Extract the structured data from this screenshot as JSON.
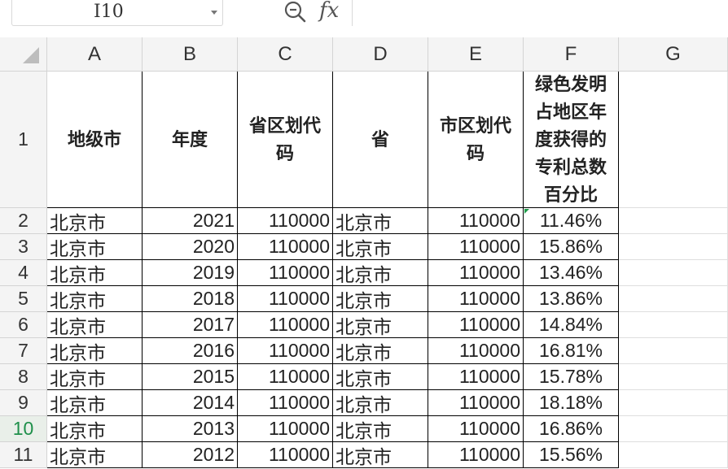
{
  "formula_bar": {
    "cell_ref": "I10",
    "fx_label": "fx",
    "formula_value": ""
  },
  "columns": [
    "A",
    "B",
    "C",
    "D",
    "E",
    "F",
    "G"
  ],
  "header_row": {
    "row_number": "1",
    "A": "地级市",
    "B": "年度",
    "C": "省区划代码",
    "D": "省",
    "E": "市区划代码",
    "F": "绿色发明占地区年度获得的专利总数百分比"
  },
  "rows": [
    {
      "n": "2",
      "A": "北京市",
      "B": "2021",
      "C": "110000",
      "D": "北京市",
      "E": "110000",
      "F": "11.46%"
    },
    {
      "n": "3",
      "A": "北京市",
      "B": "2020",
      "C": "110000",
      "D": "北京市",
      "E": "110000",
      "F": "15.86%"
    },
    {
      "n": "4",
      "A": "北京市",
      "B": "2019",
      "C": "110000",
      "D": "北京市",
      "E": "110000",
      "F": "13.46%"
    },
    {
      "n": "5",
      "A": "北京市",
      "B": "2018",
      "C": "110000",
      "D": "北京市",
      "E": "110000",
      "F": "13.86%"
    },
    {
      "n": "6",
      "A": "北京市",
      "B": "2017",
      "C": "110000",
      "D": "北京市",
      "E": "110000",
      "F": "14.84%"
    },
    {
      "n": "7",
      "A": "北京市",
      "B": "2016",
      "C": "110000",
      "D": "北京市",
      "E": "110000",
      "F": "16.81%"
    },
    {
      "n": "8",
      "A": "北京市",
      "B": "2015",
      "C": "110000",
      "D": "北京市",
      "E": "110000",
      "F": "15.78%"
    },
    {
      "n": "9",
      "A": "北京市",
      "B": "2014",
      "C": "110000",
      "D": "北京市",
      "E": "110000",
      "F": "18.18%"
    },
    {
      "n": "10",
      "A": "北京市",
      "B": "2013",
      "C": "110000",
      "D": "北京市",
      "E": "110000",
      "F": "16.86%"
    },
    {
      "n": "11",
      "A": "北京市",
      "B": "2012",
      "C": "110000",
      "D": "北京市",
      "E": "110000",
      "F": "15.56%"
    }
  ],
  "active_row": "10",
  "colors": {
    "active_row_header": "#1e8f4a",
    "header_bg": "#f4f4f4",
    "gridline": "#dedede"
  },
  "icons": {
    "zoom": "zoom-out-icon",
    "dropdown": "chevron-down-icon"
  }
}
